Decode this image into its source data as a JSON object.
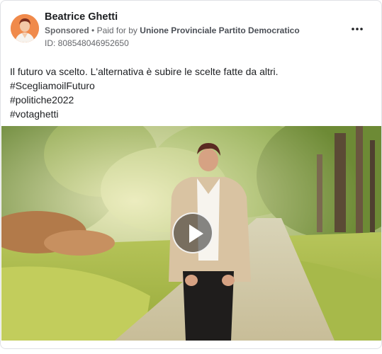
{
  "post": {
    "author": "Beatrice Ghetti",
    "sponsored_label": "Sponsored",
    "separator": "•",
    "paid_for_label": "Paid for by",
    "paid_for_org": "Unione Provinciale Partito Democratico",
    "id_label": "ID: 808548046952650",
    "more_icon": "more-horizontal-icon",
    "text_lines": [
      "Il futuro va scelto. L'alternativa è subire le scelte fatte da altri.",
      "#ScegliamoilFuturo",
      "#politiche2022",
      "#votaghetti"
    ]
  },
  "video": {
    "play_icon": "play-icon"
  },
  "colors": {
    "text_primary": "#1c1e21",
    "text_secondary": "#65676b",
    "border": "#dfe1e5",
    "avatar_bg": "#f08a4b"
  }
}
